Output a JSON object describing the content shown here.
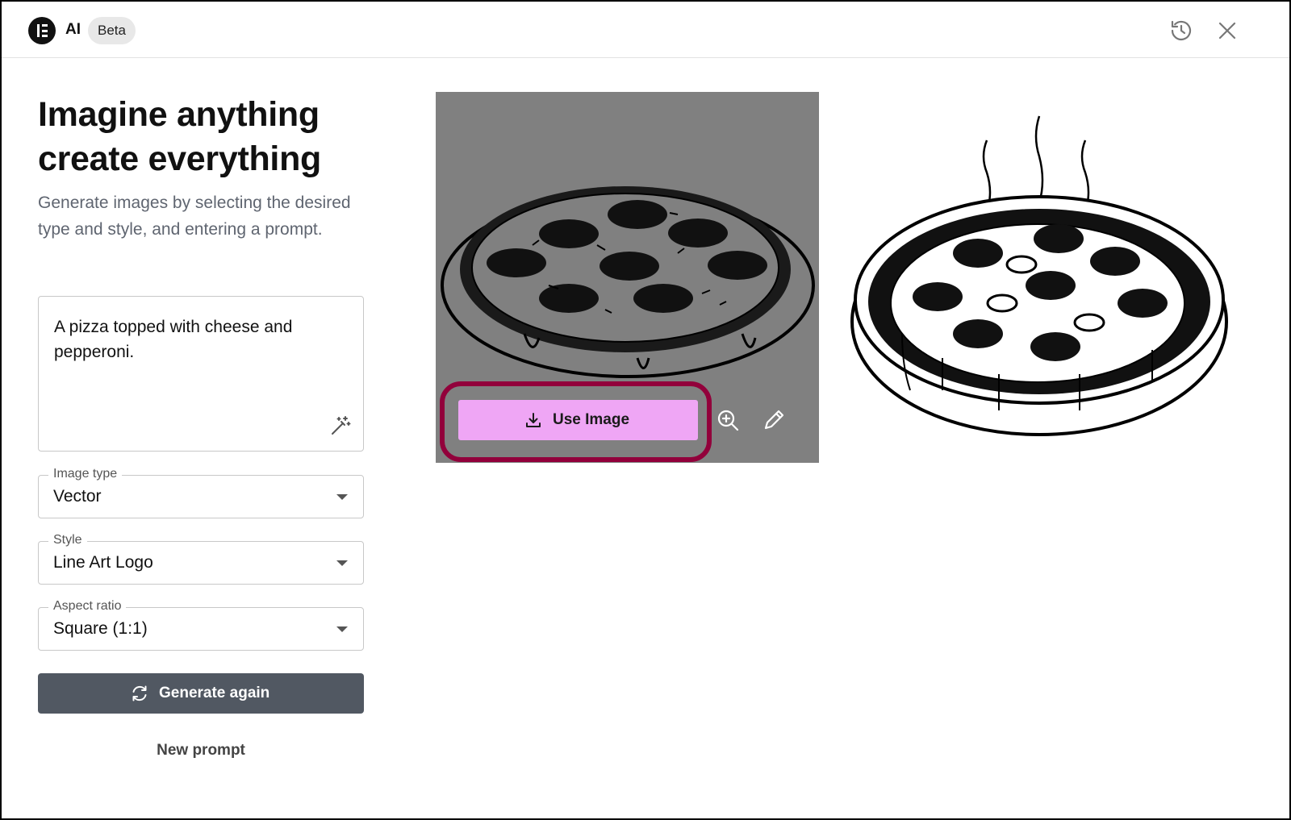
{
  "header": {
    "app_label": "AI",
    "badge": "Beta",
    "history_icon": "history-icon",
    "close_icon": "close-icon"
  },
  "left": {
    "headline_line1": "Imagine anything",
    "headline_line2": "create everything",
    "description": "Generate images by selecting the desired type and style, and entering a prompt.",
    "prompt_value": "A pizza topped with cheese and pepperoni.",
    "enhance_icon": "magic-wand-icon",
    "image_type": {
      "label": "Image type",
      "value": "Vector"
    },
    "style": {
      "label": "Style",
      "value": "Line Art Logo"
    },
    "aspect_ratio": {
      "label": "Aspect ratio",
      "value": "Square (1:1)"
    },
    "generate_label": "Generate again",
    "new_prompt_label": "New prompt"
  },
  "results": {
    "use_image_label": "Use Image",
    "actions": [
      "zoom-in-icon",
      "edit-pencil-icon"
    ],
    "selected_overlay": "#808080",
    "highlight_color": "#92003b",
    "use_button_color": "#efa6f5"
  }
}
